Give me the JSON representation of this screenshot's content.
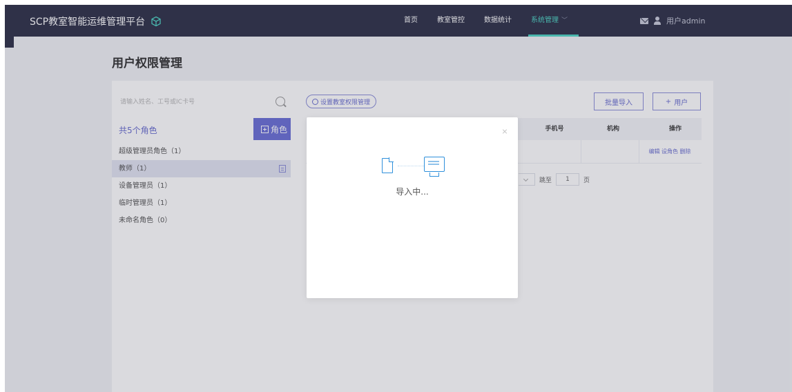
{
  "topbar": {
    "brand": "SCP教室智能运维管理平台",
    "nav": [
      {
        "label": "首页"
      },
      {
        "label": "教室管控"
      },
      {
        "label": "数据统计"
      },
      {
        "label": "系统管理"
      }
    ],
    "user_label": "用户admin"
  },
  "page": {
    "title": "用户权限管理"
  },
  "left_panel": {
    "search_placeholder": "请输入姓名、工号或IC卡号",
    "roles_count": "共5个角色",
    "add_role_label": "角色",
    "roles": [
      {
        "label": "超级管理员角色（1）"
      },
      {
        "label": "教师（1）"
      },
      {
        "label": "设备管理员（1）"
      },
      {
        "label": "临时管理员（1）"
      },
      {
        "label": "未命名角色（0）"
      }
    ]
  },
  "right_panel": {
    "perm_button": "设置教室权限管理",
    "import_button": "批量导入",
    "add_user_button": "用户",
    "add_user_plus": "+",
    "table": {
      "headers": [
        {
          "label": "手机号"
        },
        {
          "label": "机构"
        },
        {
          "label": "操作"
        }
      ],
      "row_ops": "编辑 设角色 删除"
    },
    "pager": {
      "goto_label": "跳至",
      "page_value": "1",
      "page_suffix": "页"
    }
  },
  "modal": {
    "status_text": "导入中..."
  },
  "colors": {
    "topbar": "#2f3148",
    "accent": "#6b70d6",
    "nav_active": "#4fd3c4",
    "icon_blue": "#2d8fdb"
  }
}
